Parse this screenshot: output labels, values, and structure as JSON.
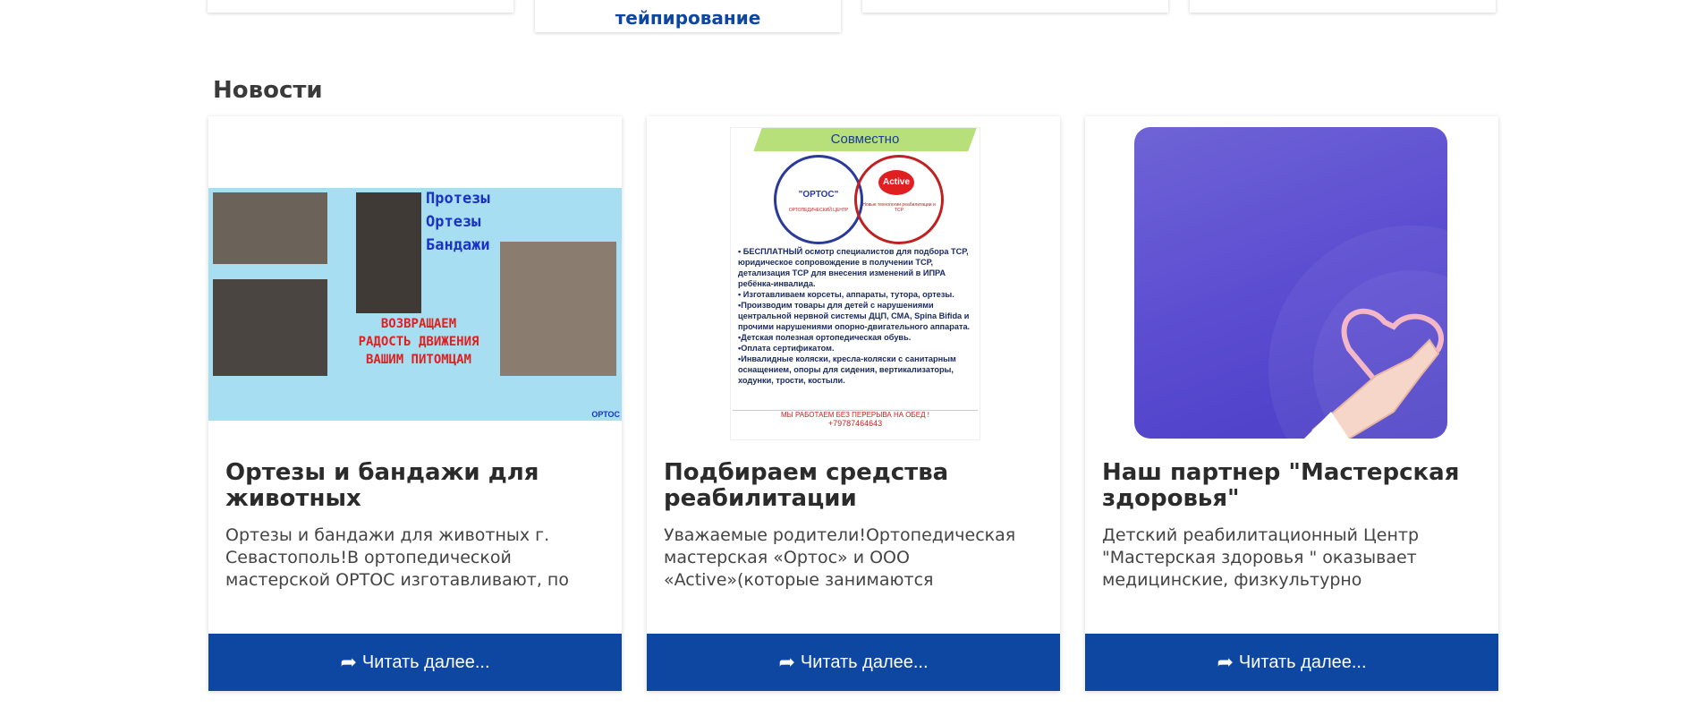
{
  "top_cards": {
    "center_label": "тейпирование"
  },
  "news": {
    "title": "Новости",
    "cards": [
      {
        "title": "Ортезы и бандажи для животных",
        "excerpt": "Ортезы и бандажи для животных г. Севастополь!В ортопедической мастерской ОРТОС изготавливают, по индивидуальному",
        "read_more": "Читать далее...",
        "image": {
          "lines": [
            "Протезы",
            "Ортезы",
            "Бандажи"
          ],
          "red_lines": [
            "ВОЗВРАЩАЕМ",
            "РАДОСТЬ ДВИЖЕНИЯ",
            "ВАШИМ ПИТОМЦАМ"
          ],
          "logo_text": "ОРТОС"
        }
      },
      {
        "title": "Подбираем средства реабилитации",
        "excerpt": "Уважаемые родители!Ортопедическая мастерская «Ортос» и ООО «Active»(которые занимаются изготовлением и обеспечением",
        "read_more": "Читать далее...",
        "image": {
          "band": "Совместно",
          "logo1": "\"ОРТОС\"",
          "logo1_sub": "ОРТОПЕДИЧЕСКИЙ ЦЕНТР",
          "logo2": "Active",
          "logo2_sub": "Новые технологии реабилитации и ТСР",
          "bullets": "• БЕСПЛАТНЫЙ осмотр специалистов для подбора ТСР, юридическое сопровождение в получении ТСР, детализация ТСР для внесения изменений в ИПРА ребёнка-инвалида.\n• Изготавливаем корсеты, аппараты, тутора, ортезы.\n•Производим товары для детей с нарушениями центральной нервной системы ДЦП, СМА, Spina Bifida и прочими нарушениями опорно-двигательного аппарата.\n•Детская полезная ортопедическая обувь.\n•Оплата сертификатом.\n•Инвалидные коляски, кресла-коляски с санитарным оснащением, опоры для сидения, вертикализаторы, ходунки, трости, костыли.",
          "footer": "МЫ РАБОТАЕМ БЕЗ ПЕРЕРЫВА НА ОБЕД !",
          "phone": "+79787464643"
        }
      },
      {
        "title": "Наш партнер \"Мастерская здоровья\"",
        "excerpt": "Детский реабилитационный Центр \"Мастерская здоровья \" оказывает медицинские, физкультурно",
        "read_more": "Читать далее...",
        "image": {}
      }
    ]
  },
  "colors": {
    "accent": "#0d47a1",
    "card_bg": "#ffffff",
    "partner_bg": "#5a4bd0"
  },
  "icons": {
    "read_more": "share-arrow-icon"
  }
}
